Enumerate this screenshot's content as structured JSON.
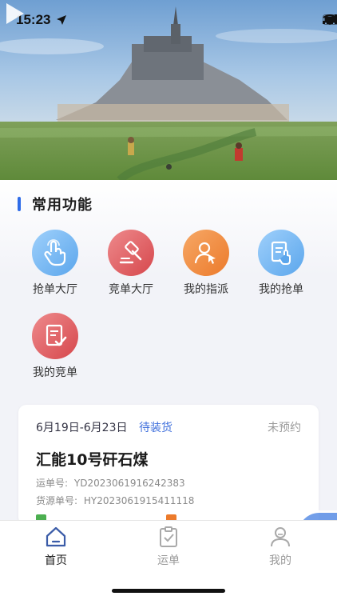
{
  "status_bar": {
    "time": "15:23"
  },
  "banner": {
    "page_count": 1,
    "active_index": 0
  },
  "section": {
    "title": "常用功能"
  },
  "functions": [
    {
      "label": "抢单大厅",
      "icon": "tap-hand-icon",
      "color": "#5ba6ec"
    },
    {
      "label": "竞单大厅",
      "icon": "gavel-icon",
      "color": "#d6474c"
    },
    {
      "label": "我的指派",
      "icon": "user-pointer-icon",
      "color": "#ec7a2b"
    },
    {
      "label": "我的抢单",
      "icon": "document-hand-icon",
      "color": "#5ba6ec"
    },
    {
      "label": "我的竞单",
      "icon": "document-check-icon",
      "color": "#d6474c"
    }
  ],
  "order": {
    "date_range": "6月19日-6月23日",
    "status": "待装货",
    "booking": "未预约",
    "title": "汇能10号矸石煤",
    "waybill_label": "运单号:",
    "waybill_no": "YD2023061916242383",
    "source_label": "货源单号:",
    "source_no": "HY2023061915411118",
    "tag_colors": [
      "#4caf50",
      "#ec7a2b"
    ]
  },
  "tabs": [
    {
      "label": "首页",
      "icon": "home-icon",
      "active": true
    },
    {
      "label": "运单",
      "icon": "clipboard-check-icon",
      "active": false
    },
    {
      "label": "我的",
      "icon": "user-icon",
      "active": false
    }
  ],
  "colors": {
    "accent": "#2f6ce8",
    "status_blue": "#3f6fdc"
  }
}
